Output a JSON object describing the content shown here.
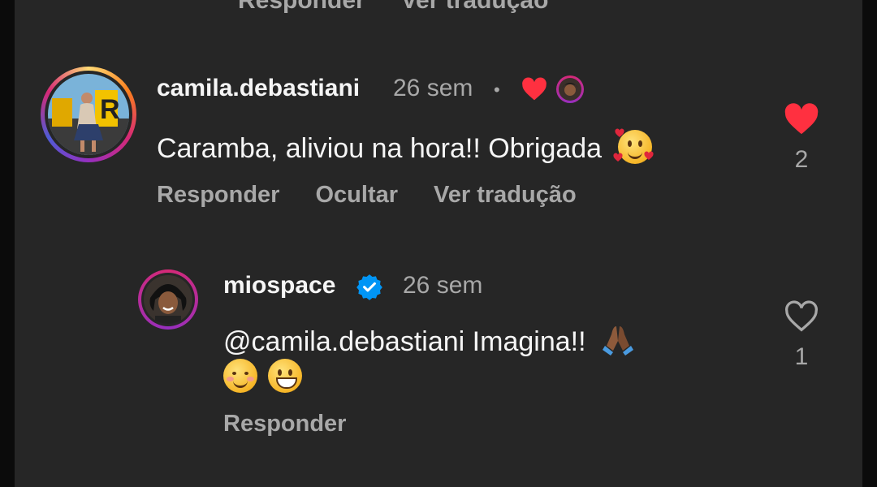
{
  "previous": {
    "reply_label": "Responder",
    "translate_label": "Ver tradução"
  },
  "comment1": {
    "username": "camila.debastiani",
    "time": "26 sem",
    "separator": "•",
    "text": "Caramba, aliviou na hora!! Obrigada",
    "emoji": "smiling-face-with-hearts",
    "actions": {
      "reply": "Responder",
      "hide": "Ocultar",
      "translate": "Ver tradução"
    },
    "like_count": "2",
    "liked": true,
    "liked_by_creator": true
  },
  "comment2": {
    "username": "miospace",
    "verified": true,
    "time": "26 sem",
    "mention": "@camila.debastiani",
    "text": "Imagina!!",
    "emojis": [
      "folded-hands",
      "smiling-face",
      "grinning-face"
    ],
    "actions": {
      "reply": "Responder"
    },
    "like_count": "1",
    "liked": false
  },
  "colors": {
    "like_red": "#ff3040",
    "verified_blue": "#0095f6",
    "background": "#262626",
    "secondary_text": "#a8a8a8"
  }
}
